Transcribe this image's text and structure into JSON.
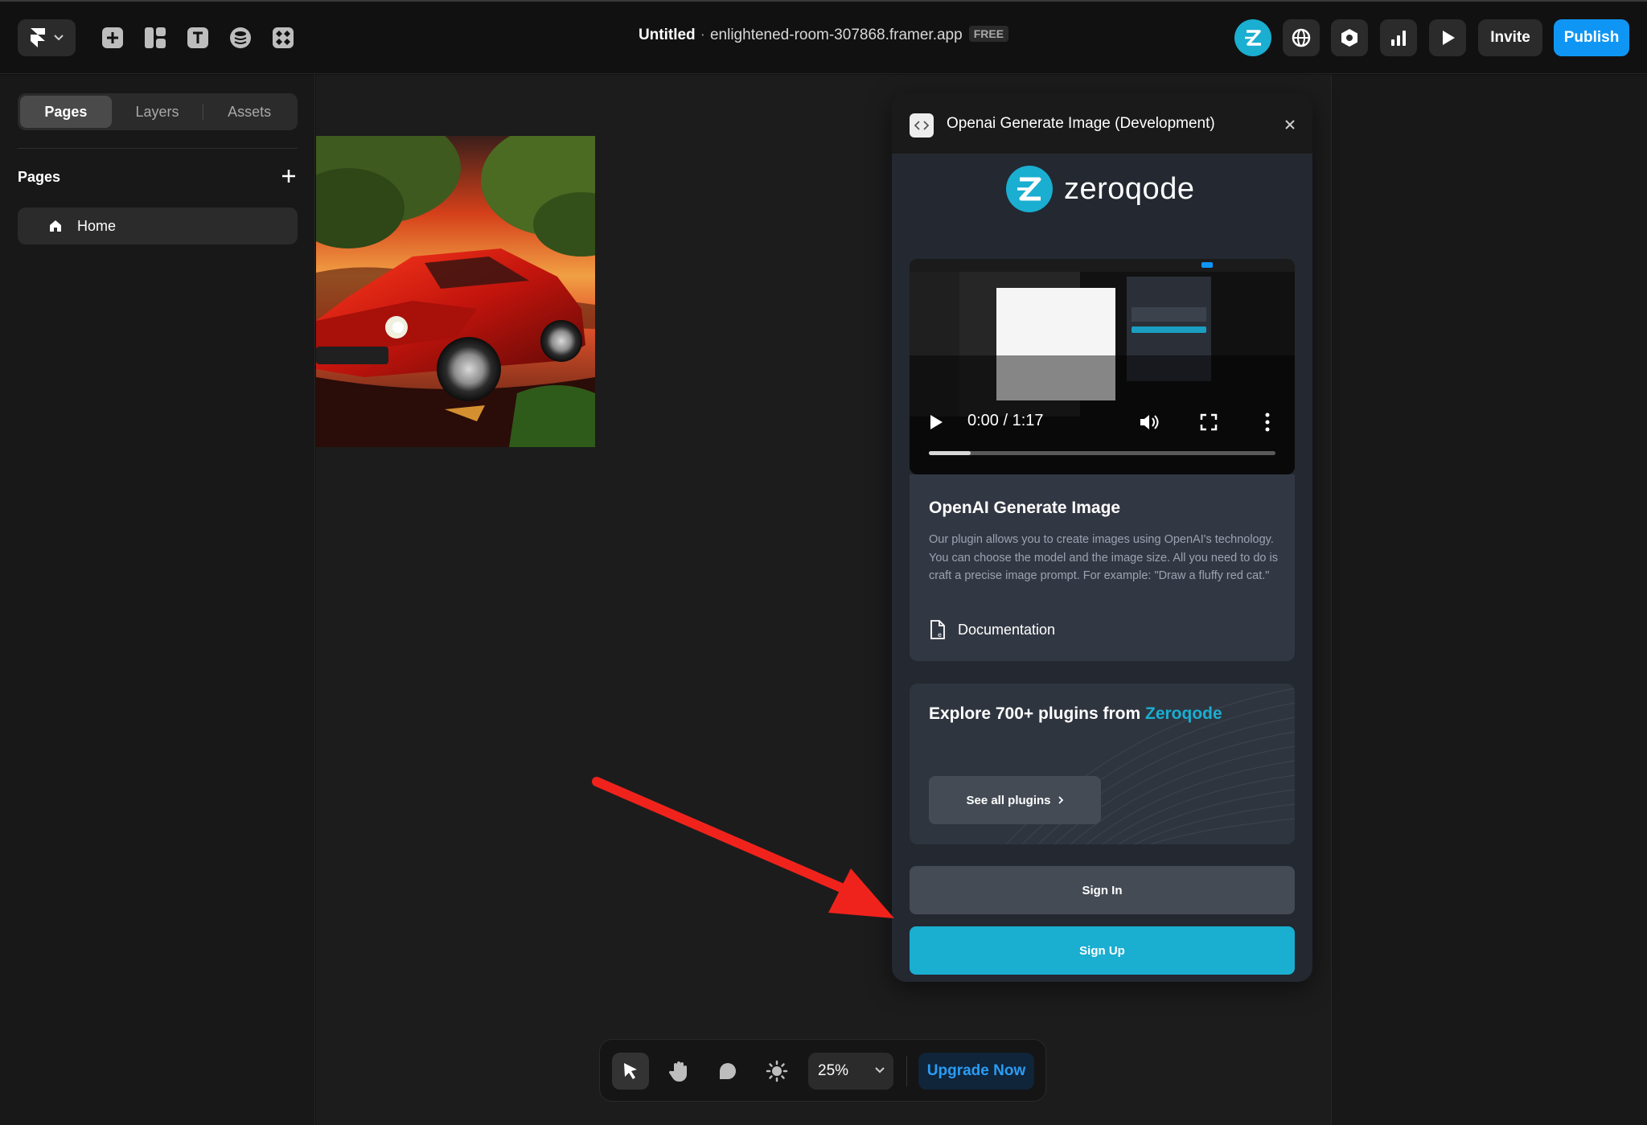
{
  "topbar": {
    "doc_name": "Untitled",
    "separator": "·",
    "site_url": "enlightened-room-307868.framer.app",
    "plan_badge": "FREE",
    "invite_label": "Invite",
    "publish_label": "Publish",
    "tools": [
      "add-icon",
      "layout-icon",
      "text-icon",
      "cms-icon",
      "components-icon"
    ],
    "right_icons": [
      "zeroqode-avatar",
      "globe-icon",
      "settings-hex-icon",
      "analytics-icon",
      "play-icon"
    ]
  },
  "sidebar": {
    "tabs": [
      {
        "label": "Pages",
        "active": true
      },
      {
        "label": "Layers",
        "active": false
      },
      {
        "label": "Assets",
        "active": false
      }
    ],
    "section_title": "Pages",
    "pages": [
      {
        "label": "Home",
        "icon": "home-icon"
      }
    ]
  },
  "plugin": {
    "title": "Openai Generate Image (Development)",
    "brand_word": "zeroqode",
    "video": {
      "time": "0:00 / 1:17",
      "progress": 0.12
    },
    "card": {
      "heading": "OpenAI Generate Image",
      "description": "Our plugin allows you to create images using OpenAI's technology. You can choose the model and the image size. All you need to do is craft a precise image prompt. For example: \"Draw a fluffy red cat.\"",
      "doc_label": "Documentation"
    },
    "explore": {
      "heading_prefix": "Explore 700+ plugins from",
      "heading_brand": "Zeroqode",
      "button_label": "See all plugins"
    },
    "sign_in_label": "Sign In",
    "sign_up_label": "Sign Up"
  },
  "bottom_toolbar": {
    "tools": [
      "select-arrow-icon",
      "hand-icon",
      "comment-icon",
      "brightness-icon"
    ],
    "zoom_label": "25%",
    "upgrade_label": "Upgrade Now"
  },
  "colors": {
    "accent_blue": "#0f96f5",
    "zeroqode_cyan": "#1aaed1",
    "annotation_red": "#f0231c"
  }
}
